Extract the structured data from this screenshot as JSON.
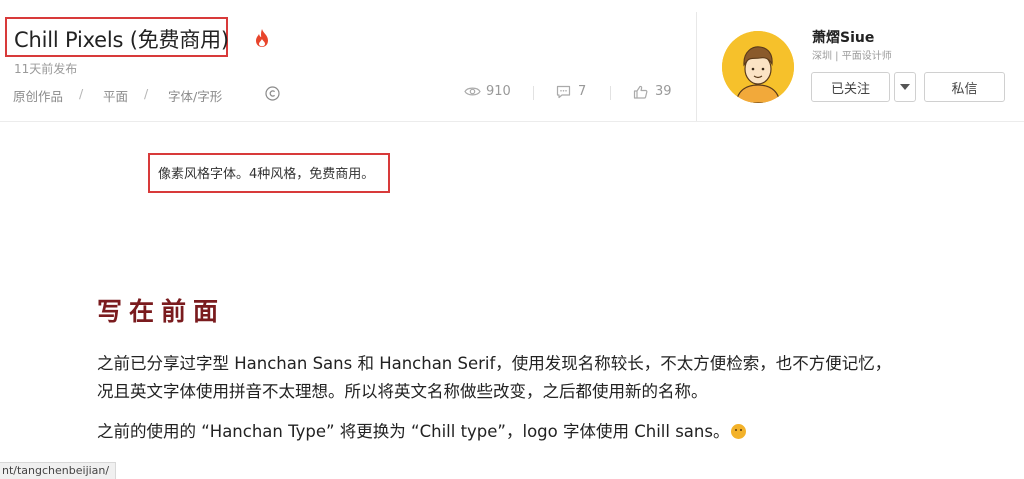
{
  "work": {
    "title": "Chill Pixels (免费商用)",
    "posted": "11天前发布",
    "breadcrumb": [
      "原创作品",
      "平面",
      "字体/字形"
    ],
    "breadcrumb_sep": "/",
    "stats": {
      "views": "910",
      "comments": "7",
      "likes": "39"
    }
  },
  "author": {
    "name": "萧熠Siue",
    "meta": "深圳 | 平面设计师",
    "follow_label": "已关注",
    "message_label": "私信"
  },
  "content": {
    "summary": "像素风格字体。4种风格，免费商用。",
    "section_title": "写在前面",
    "paragraph_1_line_1": "之前已分享过字型 Hanchan Sans 和 Hanchan Serif，使用发现名称较长，不太方便检索，也不方便记忆，",
    "paragraph_1_line_2": "况且英文字体使用拼音不太理想。所以将英文名称做些改变，之后都使用新的名称。",
    "paragraph_2": "之前的使用的 “Hanchan Type” 将更换为 “Chill type”，logo 字体使用 Chill sans。"
  },
  "status_bar": {
    "url": "nt/tangchenbeijian/"
  },
  "colors": {
    "highlight_border": "#d83a3a",
    "section_title": "#7a1b1e",
    "avatar_bg": "#f6c12b",
    "fire": "#e8452c"
  },
  "icons": [
    "fire-icon",
    "cc-license-icon",
    "eye-icon",
    "comment-icon",
    "thumbs-up-icon",
    "chevron-down-icon",
    "emoji-icon"
  ]
}
